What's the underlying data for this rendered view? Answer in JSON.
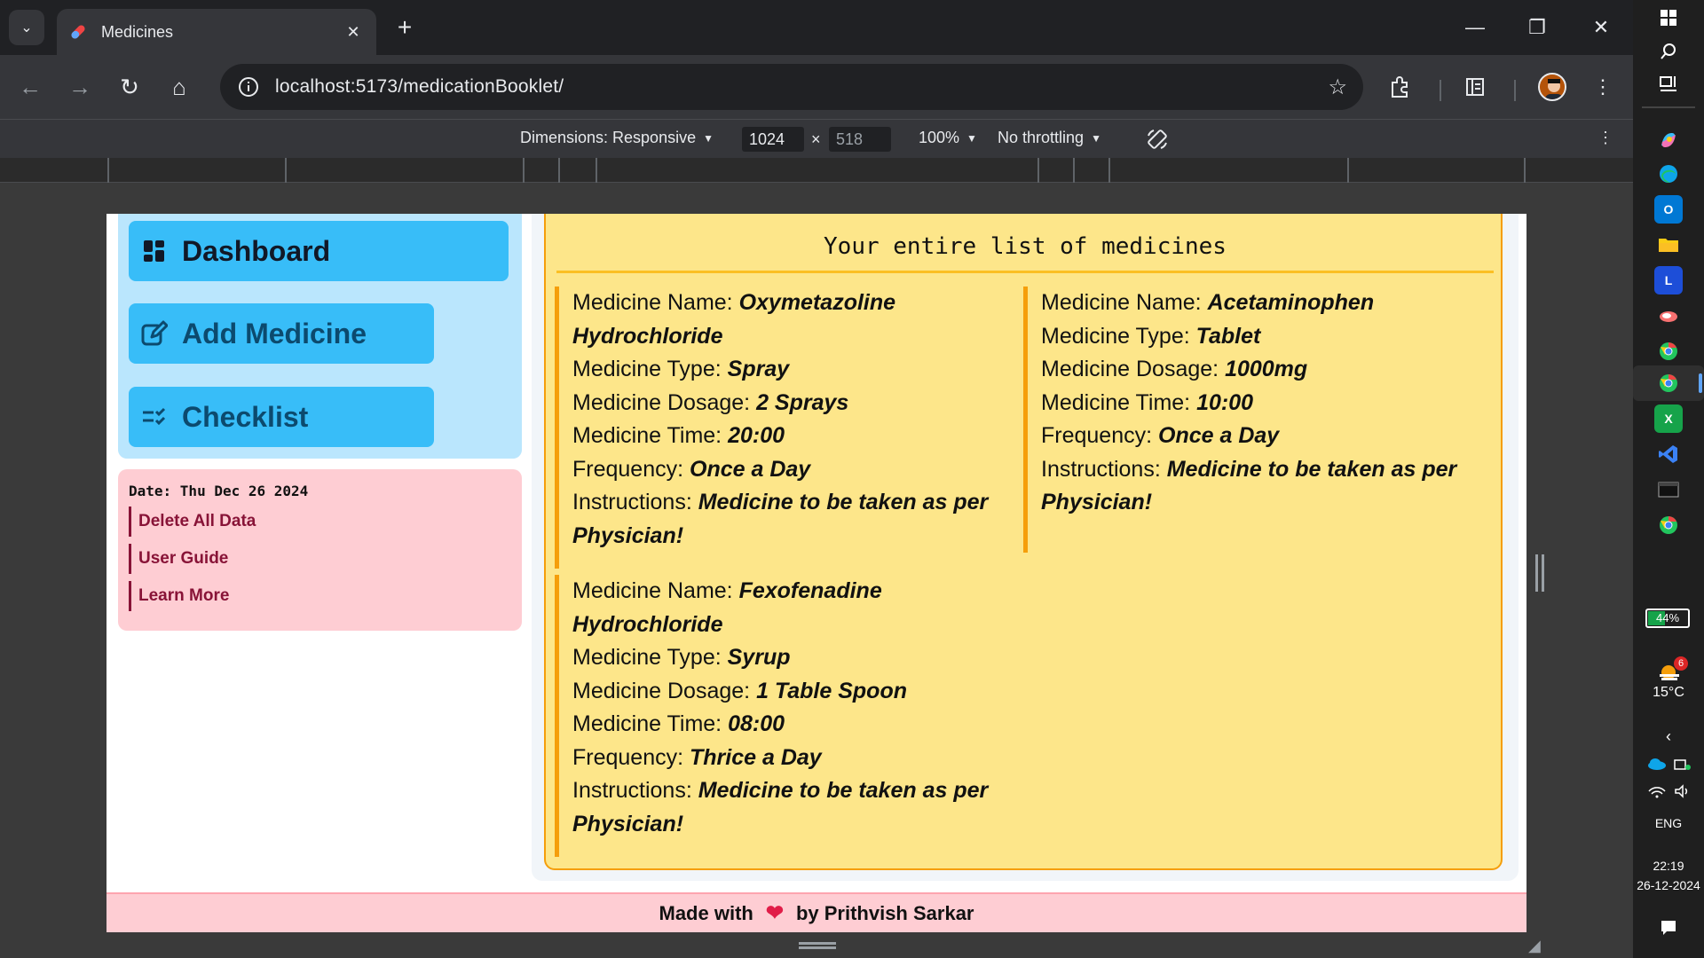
{
  "browser": {
    "tab_title": "Medicines",
    "url_host": "localhost",
    "url_path": ":5173/medicationBooklet/",
    "devtools": {
      "dimensions_label": "Dimensions: Responsive",
      "width": "1024",
      "times": "×",
      "height": "518",
      "zoom": "100%",
      "throttling": "No throttling"
    }
  },
  "sidebar": {
    "dashboard_label": "Dashboard",
    "add_medicine_label": "Add Medicine",
    "checklist_label": "Checklist"
  },
  "info": {
    "date": "Date: Thu Dec 26 2024",
    "delete_label": "Delete All Data",
    "guide_label": "User Guide",
    "learn_label": "Learn More"
  },
  "main": {
    "title": "Your entire list of medicines",
    "field_labels": {
      "name": "Medicine Name: ",
      "type": "Medicine Type: ",
      "dosage": "Medicine Dosage: ",
      "time": "Medicine Time: ",
      "frequency": "Frequency: ",
      "instructions": "Instructions: "
    },
    "medicines": [
      {
        "name": "Oxymetazoline Hydrochloride",
        "type": "Spray",
        "dosage": "2 Sprays",
        "time": "20:00",
        "frequency": "Once a Day",
        "instructions": "Medicine to be taken as per Physician!"
      },
      {
        "name": "Acetaminophen",
        "type": "Tablet",
        "dosage": "1000mg",
        "time": "10:00",
        "frequency": "Once a Day",
        "instructions": "Medicine to be taken as per Physician!"
      },
      {
        "name": "Fexofenadine Hydrochloride",
        "type": "Syrup",
        "dosage": "1 Table Spoon",
        "time": "08:00",
        "frequency": "Thrice a Day",
        "instructions": "Medicine to be taken as per Physician!"
      }
    ]
  },
  "footer": {
    "prefix": "Made with",
    "heart": "❤",
    "suffix": "by Prithvish Sarkar"
  },
  "taskbar": {
    "battery": "44%",
    "battery_level": 0.44,
    "weather_temp": "15°C",
    "weather_badge": "6",
    "language": "ENG",
    "time": "22:19",
    "date": "26-12-2024"
  },
  "colors": {
    "sidebar_bg": "#bae6fd",
    "nav_button": "#38bdf8",
    "info_bg": "#fecdd3",
    "med_panel": "#fde68a",
    "med_accent": "#f59e0b",
    "heart": "#e11d48"
  }
}
